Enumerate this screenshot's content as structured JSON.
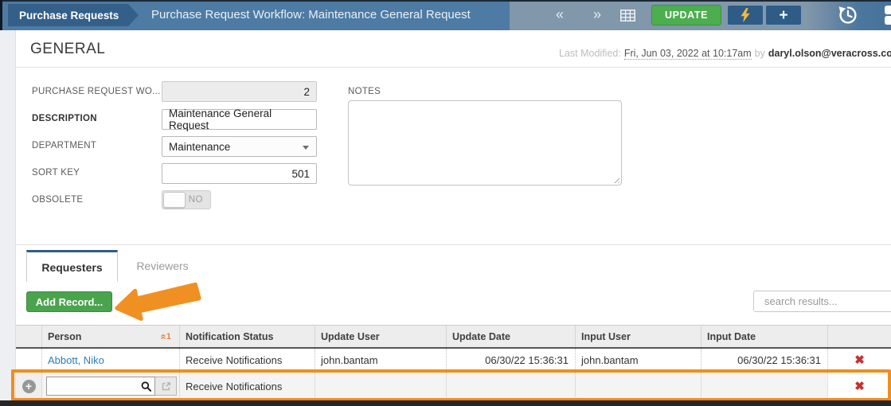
{
  "header": {
    "breadcrumb": "Purchase Requests",
    "title": "Purchase Request Workflow: Maintenance General Request",
    "update_button": "UPDATE",
    "icons": {
      "prev": "«",
      "next": "»",
      "plus": "+"
    }
  },
  "general": {
    "title": "GENERAL",
    "last_modified": {
      "label": "Last Modified:",
      "value": "Fri, Jun 03, 2022 at 10:17am",
      "by": "by",
      "user": "daryl.olson@veracross.com"
    },
    "fields": {
      "workflow_id": {
        "label": "PURCHASE REQUEST WO...",
        "value": "2"
      },
      "description": {
        "label": "DESCRIPTION",
        "value": "Maintenance General Request"
      },
      "department": {
        "label": "DEPARTMENT",
        "value": "Maintenance"
      },
      "sort_key": {
        "label": "SORT KEY",
        "value": "501"
      },
      "obsolete": {
        "label": "OBSOLETE",
        "value": "NO"
      },
      "notes": {
        "label": "NOTES",
        "value": ""
      }
    }
  },
  "tabs": {
    "requesters": "Requesters",
    "reviewers": "Reviewers"
  },
  "grid_toolbar": {
    "add_record": "Add Record...",
    "search_placeholder": "search results..."
  },
  "table": {
    "columns": {
      "person": "Person",
      "notification_status": "Notification Status",
      "update_user": "Update User",
      "update_date": "Update Date",
      "input_user": "Input User",
      "input_date": "Input Date"
    },
    "sort_indicator": {
      "glyph": "«",
      "order": "1"
    },
    "rows": [
      {
        "person": "Abbott, Niko",
        "notification_status": "Receive Notifications",
        "update_user": "john.bantam",
        "update_date": "06/30/22 15:36:31",
        "input_user": "john.bantam",
        "input_date": "06/30/22 15:36:31",
        "delete_glyph": "✖"
      }
    ],
    "new_row": {
      "plus_glyph": "+",
      "notification_status": "Receive Notifications",
      "delete_glyph": "✖"
    }
  },
  "colors": {
    "accent_green": "#4cae4f",
    "annotation_orange": "#ef8e1d",
    "link_blue": "#2b7cba",
    "delete_red": "#c4302e"
  }
}
